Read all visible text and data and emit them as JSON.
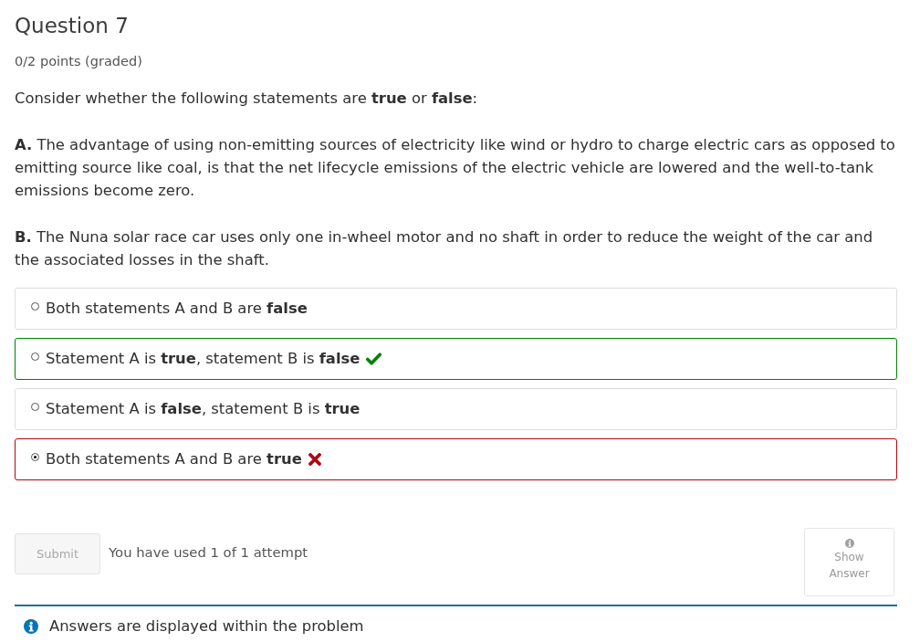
{
  "question": {
    "title": "Question 7",
    "points": "0/2 points (graded)"
  },
  "prompt": {
    "intro": "Consider whether the following statements are **true** or **false**:",
    "statements": [
      "**A.** The advantage of using non-emitting sources of electricity like wind or hydro to charge electric cars as opposed to emitting source like coal, is that the net lifecycle emissions of the electric vehicle are lowered and the well-to-tank emissions become zero.",
      "**B.** The Nuna solar race car uses only one in-wheel motor and no shaft in order to reduce the weight of the car and the associated losses in the shaft."
    ]
  },
  "options": [
    {
      "label": "Both statements A and B are **false**",
      "selected": false,
      "correct": false
    },
    {
      "label": "Statement A is **true**, statement B is **false**",
      "selected": false,
      "correct": true
    },
    {
      "label": "Statement A is **false**, statement B is **true**",
      "selected": false,
      "correct": false
    },
    {
      "label": "Both statements A and B are **true**",
      "selected": true,
      "correct": false
    }
  ],
  "actions": {
    "submit": {
      "label": "Submit",
      "disabled": true
    },
    "attempts": "You have used 1 of 1 attempt",
    "show_answer": {
      "label": "Show Answer"
    }
  },
  "notification": {
    "message": "Answers are displayed within the problem"
  }
}
